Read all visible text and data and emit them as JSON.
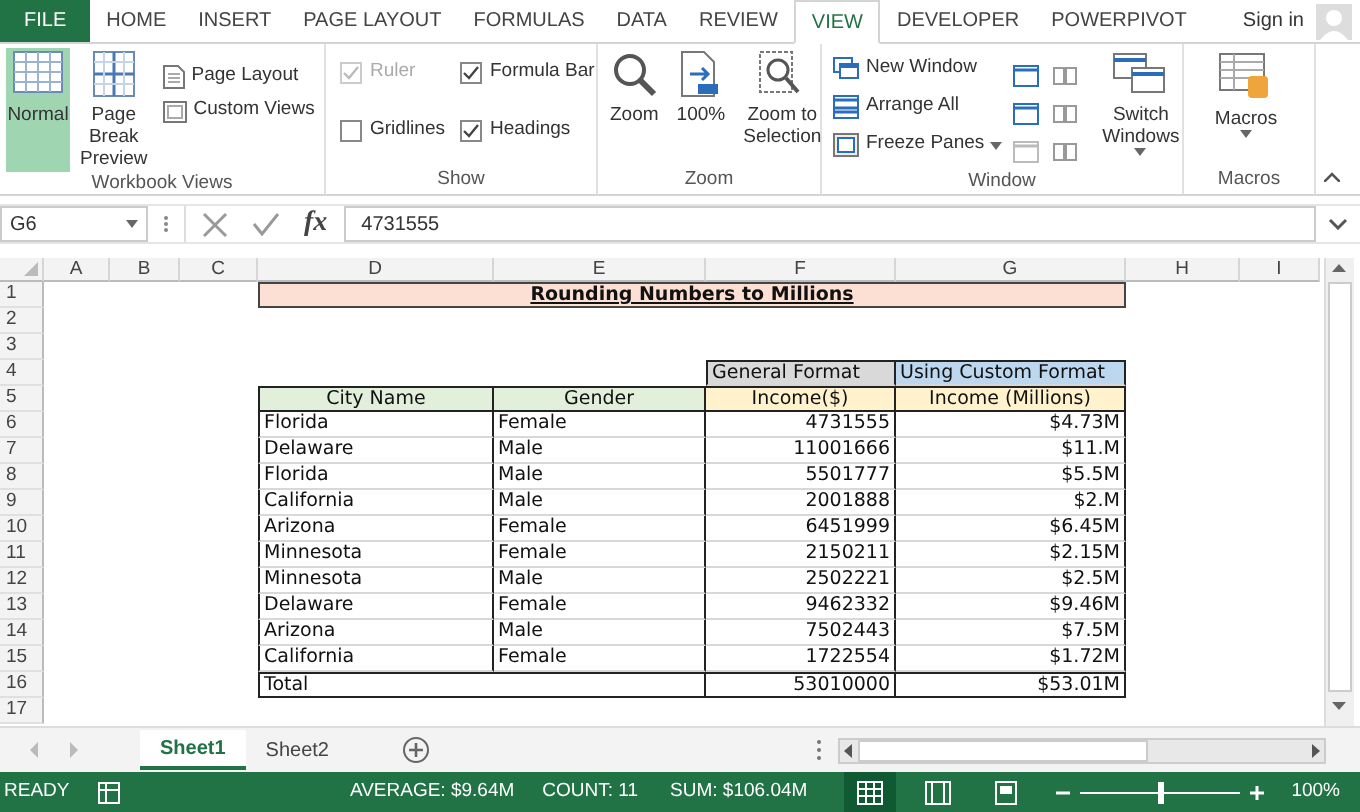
{
  "ribbon_tabs": [
    {
      "label": "FILE",
      "kind": "file",
      "selected": false
    },
    {
      "label": "HOME",
      "kind": "tab",
      "selected": false
    },
    {
      "label": "INSERT",
      "kind": "tab",
      "selected": false
    },
    {
      "label": "PAGE LAYOUT",
      "kind": "tab",
      "selected": false
    },
    {
      "label": "FORMULAS",
      "kind": "tab",
      "selected": false
    },
    {
      "label": "DATA",
      "kind": "tab",
      "selected": false
    },
    {
      "label": "REVIEW",
      "kind": "tab",
      "selected": false
    },
    {
      "label": "VIEW",
      "kind": "tab",
      "selected": true
    },
    {
      "label": "DEVELOPER",
      "kind": "tab",
      "selected": false
    },
    {
      "label": "POWERPIVOT",
      "kind": "tab",
      "selected": false
    }
  ],
  "account": {
    "label": "Sign in"
  },
  "ribbon": {
    "workbook_views": {
      "label": "Workbook Views",
      "large_buttons": [
        {
          "label": "Normal",
          "selected": true
        },
        {
          "label": "Page Break Preview",
          "selected": false
        }
      ],
      "small_buttons": [
        "Page Layout",
        "Custom Views"
      ]
    },
    "show": {
      "label": "Show",
      "checkboxes": [
        {
          "label": "Ruler",
          "checked": true,
          "disabled": true
        },
        {
          "label": "Formula Bar",
          "checked": true,
          "disabled": false
        },
        {
          "label": "Gridlines",
          "checked": false,
          "disabled": false
        },
        {
          "label": "Headings",
          "checked": true,
          "disabled": false
        }
      ]
    },
    "zoom": {
      "label": "Zoom",
      "buttons": [
        "Zoom",
        "100%",
        "Zoom to Selection"
      ]
    },
    "window": {
      "label": "Window",
      "buttons": [
        {
          "label": "New Window",
          "dropdown": false
        },
        {
          "label": "Arrange All",
          "dropdown": false
        },
        {
          "label": "Freeze Panes",
          "dropdown": true
        }
      ],
      "switch": {
        "label": "Switch Windows",
        "dropdown": true
      }
    },
    "macros": {
      "label": "Macros",
      "button": {
        "label": "Macros",
        "dropdown": true
      }
    }
  },
  "formula_bar": {
    "name_box": "G6",
    "function_symbol": "fx",
    "value": "4731555"
  },
  "sheet": {
    "columns": [
      "A",
      "B",
      "C",
      "D",
      "E",
      "F",
      "G",
      "H",
      "I"
    ],
    "rows": [
      "1",
      "2",
      "3",
      "4",
      "5",
      "6",
      "7",
      "8",
      "9",
      "10",
      "11",
      "12",
      "13",
      "14",
      "15",
      "16",
      "17"
    ],
    "title": "Rounding Numbers to Millions",
    "group_headers": [
      "General Format",
      "Using Custom Format"
    ],
    "headers": [
      "City Name",
      "Gender",
      "Income($)",
      "Income (Millions)"
    ],
    "records": [
      [
        "Florida",
        "Female",
        "4731555",
        "$4.73M"
      ],
      [
        "Delaware",
        "Male",
        "11001666",
        "$11.M"
      ],
      [
        "Florida",
        "Male",
        "5501777",
        "$5.5M"
      ],
      [
        "California",
        "Male",
        "2001888",
        "$2.M"
      ],
      [
        "Arizona",
        "Female",
        "6451999",
        "$6.45M"
      ],
      [
        "Minnesota",
        "Female",
        "2150211",
        "$2.15M"
      ],
      [
        "Minnesota",
        "Male",
        "2502221",
        "$2.5M"
      ],
      [
        "Delaware",
        "Female",
        "9462332",
        "$9.46M"
      ],
      [
        "Arizona",
        "Male",
        "7502443",
        "$7.5M"
      ],
      [
        "California",
        "Female",
        "1722554",
        "$1.72M"
      ]
    ],
    "total": [
      "Total",
      "53010000",
      "$53.01M"
    ]
  },
  "sheet_tabs": [
    {
      "label": "Sheet1",
      "selected": true
    },
    {
      "label": "Sheet2",
      "selected": false
    }
  ],
  "status_bar": {
    "mode": "READY",
    "average": "AVERAGE: $9.64M",
    "count": "COUNT: 11",
    "sum": "SUM: $106.04M",
    "views": [
      {
        "kind": "normal",
        "selected": true
      },
      {
        "kind": "page_layout",
        "selected": false
      },
      {
        "kind": "page_break",
        "selected": false
      }
    ],
    "zoom": {
      "level": 0.5,
      "reading": "100%"
    }
  }
}
